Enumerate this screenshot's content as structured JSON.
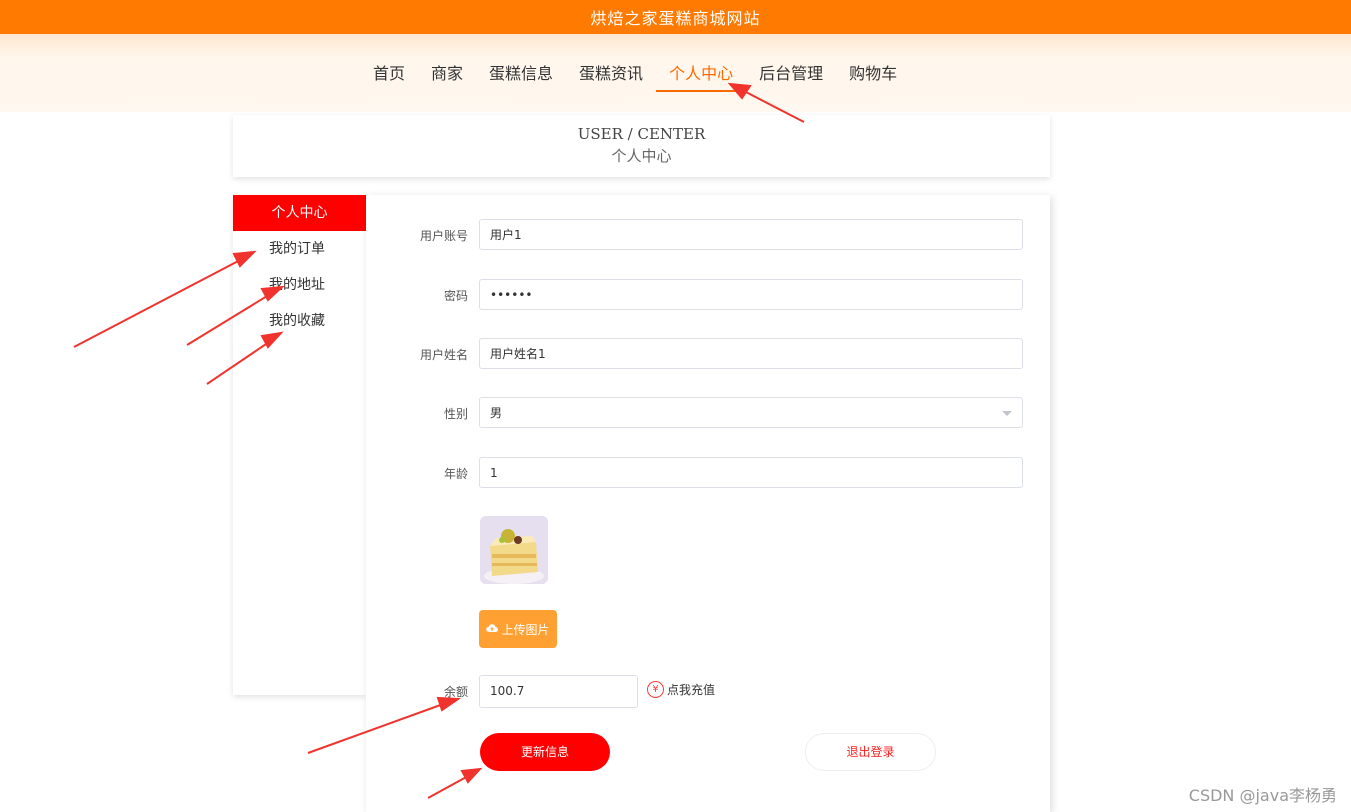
{
  "site": {
    "title": "烘焙之家蛋糕商城网站"
  },
  "nav": {
    "items": [
      {
        "label": "首页"
      },
      {
        "label": "商家"
      },
      {
        "label": "蛋糕信息"
      },
      {
        "label": "蛋糕资讯"
      },
      {
        "label": "个人中心",
        "active": true
      },
      {
        "label": "后台管理"
      },
      {
        "label": "购物车"
      }
    ]
  },
  "header": {
    "en": "USER / CENTER",
    "cn": "个人中心"
  },
  "sidebar": {
    "items": [
      {
        "label": "个人中心",
        "active": true
      },
      {
        "label": "我的订单"
      },
      {
        "label": "我的地址"
      },
      {
        "label": "我的收藏"
      }
    ]
  },
  "form": {
    "account": {
      "label": "用户账号",
      "value": "用户1"
    },
    "password": {
      "label": "密码",
      "value": "••••••"
    },
    "name": {
      "label": "用户姓名",
      "value": "用户姓名1"
    },
    "gender": {
      "label": "性别",
      "value": "男"
    },
    "age": {
      "label": "年龄",
      "value": "1"
    },
    "upload_label": "上传图片",
    "balance": {
      "label": "余额",
      "value": "100.7"
    },
    "recharge_label": "点我充值",
    "recharge_icon": "¥",
    "update_label": "更新信息",
    "logout_label": "退出登录"
  },
  "colors": {
    "brand": "#ff7a00",
    "accent": "#ff0000",
    "upload": "#ffa033"
  },
  "watermark": "CSDN @java李杨勇"
}
